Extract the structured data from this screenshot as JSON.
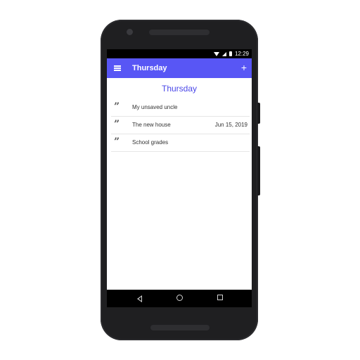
{
  "statusbar": {
    "time": "12:29"
  },
  "appbar": {
    "title": "Thursday",
    "add_icon": "+"
  },
  "day_header": "Thursday",
  "entries": [
    {
      "title": "My unsaved uncle",
      "date": ""
    },
    {
      "title": "The new house",
      "date": "Jun 15, 2019"
    },
    {
      "title": "School grades",
      "date": ""
    }
  ],
  "icons": {
    "menu": "menu-icon",
    "add": "add-icon",
    "entry": "quote-icon",
    "wifi": "wifi-icon",
    "signal": "signal-icon",
    "battery": "battery-icon",
    "back": "back-icon",
    "home": "home-icon",
    "recents": "recents-icon"
  },
  "colors": {
    "appbar": "#5856f5",
    "day_header": "#4a47e8",
    "phone_body": "#1f1f21"
  }
}
